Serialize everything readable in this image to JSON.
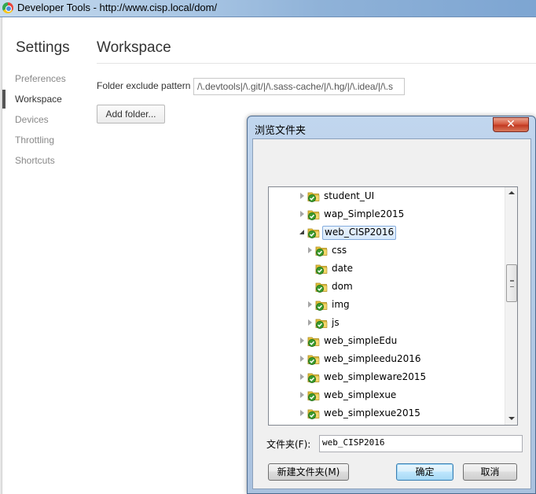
{
  "window": {
    "title": "Developer Tools - http://www.cisp.local/dom/"
  },
  "settings": {
    "title": "Settings",
    "nav": [
      {
        "label": "Preferences",
        "selected": false
      },
      {
        "label": "Workspace",
        "selected": true
      },
      {
        "label": "Devices",
        "selected": false
      },
      {
        "label": "Throttling",
        "selected": false
      },
      {
        "label": "Shortcuts",
        "selected": false
      }
    ]
  },
  "workspace": {
    "title": "Workspace",
    "exclude_label": "Folder exclude pattern",
    "exclude_value": "/\\.devtools|/\\.git/|/\\.sass-cache/|/\\.hg/|/\\.idea/|/\\.s",
    "add_folder_label": "Add folder..."
  },
  "dialog": {
    "title": "浏览文件夹",
    "close_glyph": "✕",
    "tree": [
      {
        "label": "student_UI",
        "level": 0,
        "expander": "collapsed",
        "selected": false
      },
      {
        "label": "wap_Simple2015",
        "level": 0,
        "expander": "collapsed",
        "selected": false
      },
      {
        "label": "web_CISP2016",
        "level": 0,
        "expander": "expanded",
        "selected": true
      },
      {
        "label": "css",
        "level": 1,
        "expander": "collapsed",
        "selected": false
      },
      {
        "label": "date",
        "level": 1,
        "expander": "none",
        "selected": false
      },
      {
        "label": "dom",
        "level": 1,
        "expander": "none",
        "selected": false
      },
      {
        "label": "img",
        "level": 1,
        "expander": "collapsed",
        "selected": false
      },
      {
        "label": "js",
        "level": 1,
        "expander": "collapsed",
        "selected": false
      },
      {
        "label": "web_simpleEdu",
        "level": 0,
        "expander": "collapsed",
        "selected": false
      },
      {
        "label": "web_simpleedu2016",
        "level": 0,
        "expander": "collapsed",
        "selected": false
      },
      {
        "label": "web_simpleware2015",
        "level": 0,
        "expander": "collapsed",
        "selected": false
      },
      {
        "label": "web_simplexue",
        "level": 0,
        "expander": "collapsed",
        "selected": false
      },
      {
        "label": "web_simplexue2015",
        "level": 0,
        "expander": "collapsed",
        "selected": false
      }
    ],
    "folder_label": "文件夹(F):",
    "folder_value": "web_CISP2016",
    "new_folder_label": "新建文件夹(M)",
    "ok_label": "确定",
    "cancel_label": "取消"
  },
  "colors": {
    "folder_yellow": "#e8c43a",
    "check_green": "#3a9a2c",
    "selection_border": "#84acdd"
  }
}
